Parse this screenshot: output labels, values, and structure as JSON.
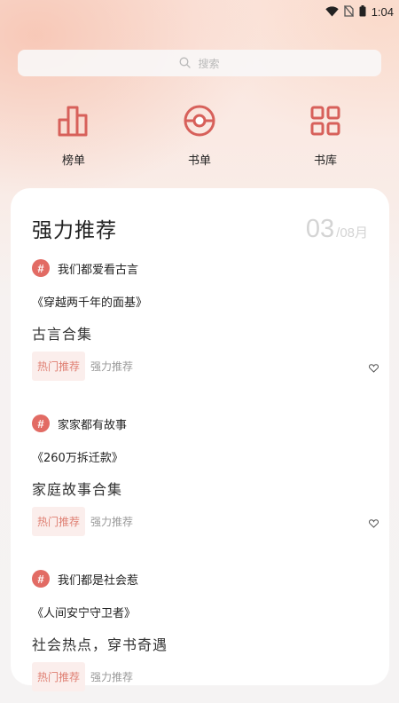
{
  "status": {
    "time": "1:04",
    "icons": [
      "wifi-icon",
      "no-sim-icon",
      "battery-icon"
    ]
  },
  "search": {
    "placeholder": "搜索",
    "icon": "search-icon"
  },
  "nav": {
    "items": [
      {
        "label": "榜单",
        "icon": "ranking-icon"
      },
      {
        "label": "书单",
        "icon": "booklist-icon"
      },
      {
        "label": "书库",
        "icon": "library-grid-icon"
      }
    ]
  },
  "card": {
    "title": "强力推荐",
    "date_day": "03",
    "date_separator": "/",
    "date_month": "08月"
  },
  "recommendations": [
    {
      "topic": "我们都爱看古言",
      "book": "《穿越两千年的面基》",
      "collection": "古言合集",
      "tag_hot": "热门推荐",
      "tag_plain": "强力推荐"
    },
    {
      "topic": "家家都有故事",
      "book": "《260万拆迁款》",
      "collection": "家庭故事合集",
      "tag_hot": "热门推荐",
      "tag_plain": "强力推荐"
    },
    {
      "topic": "我们都是社会惹",
      "book": "《人间安宁守卫者》",
      "collection": "社会热点，穿书奇遇",
      "tag_hot": "热门推荐",
      "tag_plain": "强力推荐"
    }
  ],
  "colors": {
    "accent": "#e26b64",
    "tag_bg": "#fbeeec",
    "tag_text": "#df7f72"
  }
}
